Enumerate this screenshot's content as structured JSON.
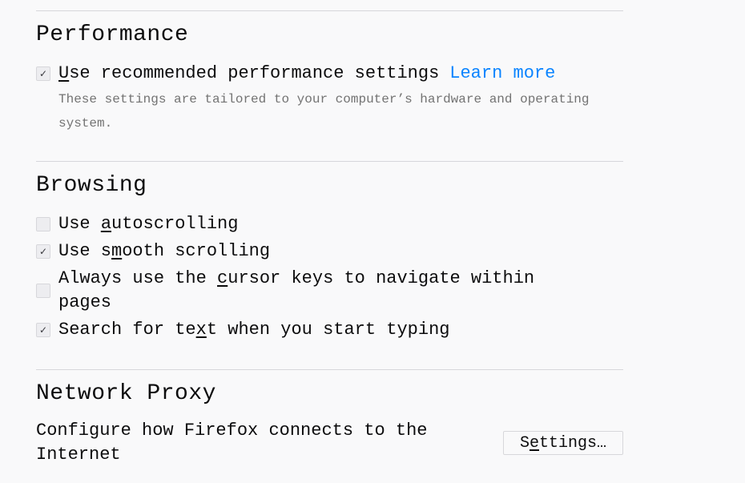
{
  "performance": {
    "title": "Performance",
    "recommended": {
      "checked": true,
      "check_glyph": "✓",
      "label_pre": "",
      "label_key": "U",
      "label_post": "se recommended performance settings",
      "learn_more": "Learn more"
    },
    "description": "These settings are tailored to your computer’s hardware and operating system."
  },
  "browsing": {
    "title": "Browsing",
    "items": [
      {
        "checked": false,
        "check_glyph": "",
        "pre": "Use ",
        "key": "a",
        "post": "utoscrolling"
      },
      {
        "checked": true,
        "check_glyph": "✓",
        "pre": "Use s",
        "key": "m",
        "post": "ooth scrolling"
      },
      {
        "checked": false,
        "check_glyph": "",
        "pre": "Always use the ",
        "key": "c",
        "post": "ursor keys to navigate within\npages"
      },
      {
        "checked": true,
        "check_glyph": "✓",
        "pre": "Search for te",
        "key": "x",
        "post": "t when you start typing"
      }
    ]
  },
  "network_proxy": {
    "title": "Network Proxy",
    "description": "Configure how Firefox connects to the Internet",
    "settings_button": {
      "pre": "S",
      "key": "e",
      "post": "ttings…"
    }
  },
  "colors": {
    "link": "#0a84ff",
    "muted": "#737373"
  }
}
